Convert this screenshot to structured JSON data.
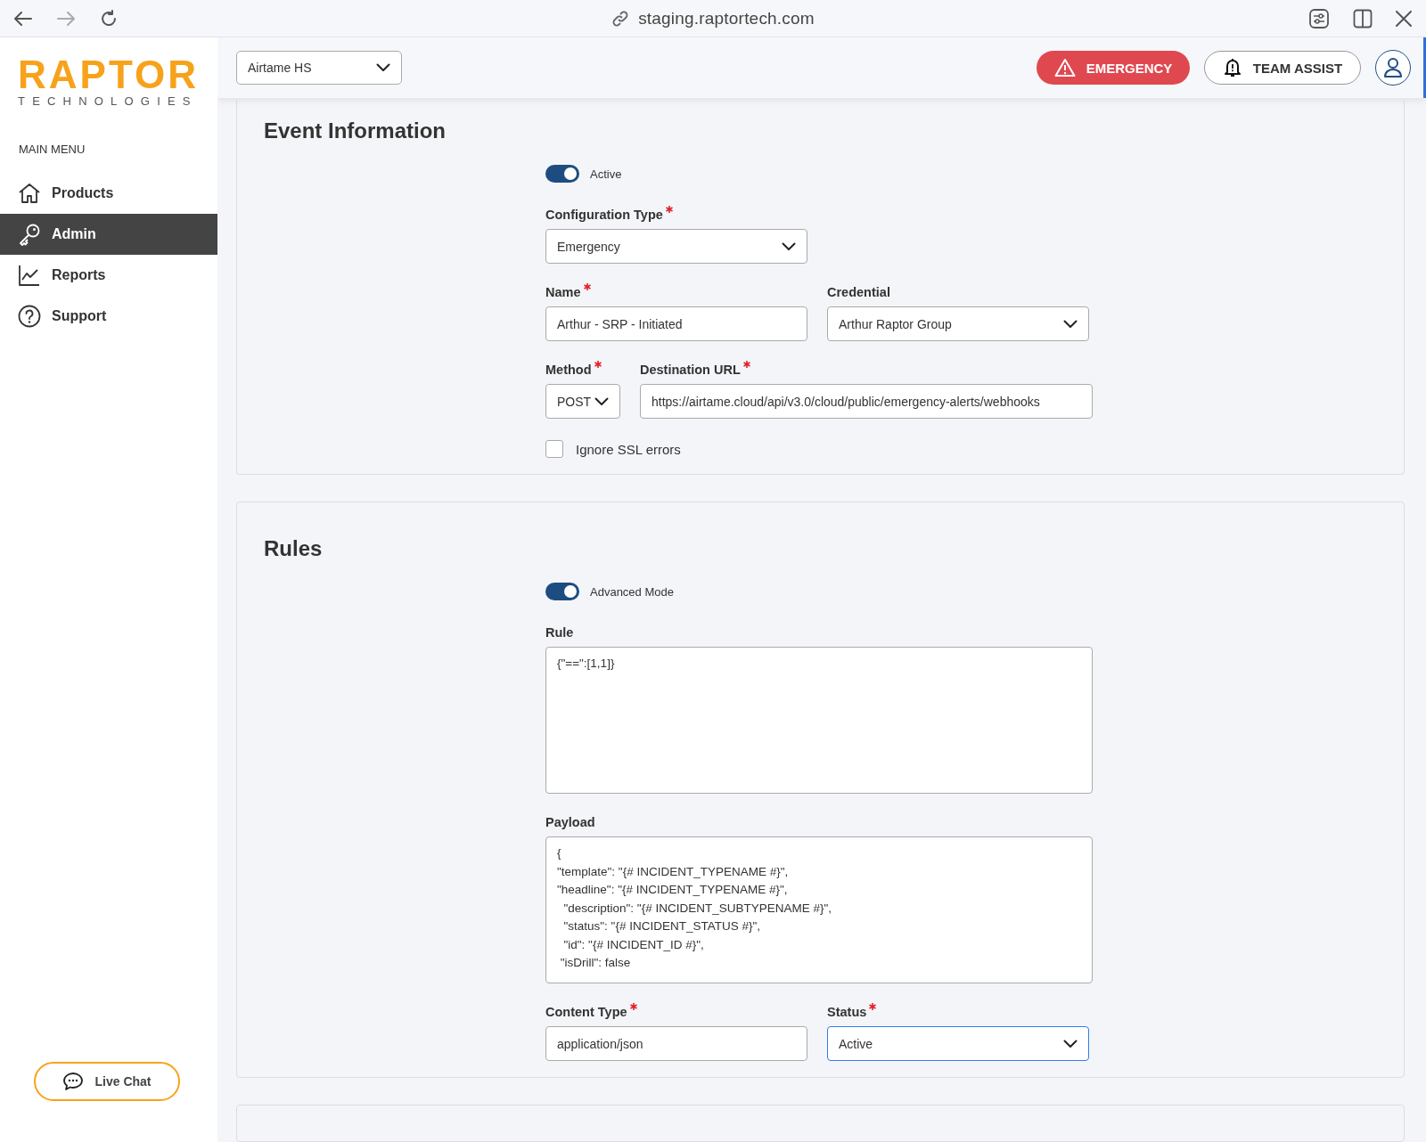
{
  "browser": {
    "url": "staging.raptortech.com"
  },
  "logo": {
    "name": "RAPTOR",
    "tagline": "TECHNOLOGIES"
  },
  "sidebar": {
    "heading": "MAIN MENU",
    "items": [
      {
        "label": "Products",
        "selected": false
      },
      {
        "label": "Admin",
        "selected": true
      },
      {
        "label": "Reports",
        "selected": false
      },
      {
        "label": "Support",
        "selected": false
      }
    ],
    "live_chat": "Live Chat"
  },
  "header": {
    "site_select": "Airtame HS",
    "emergency": "EMERGENCY",
    "team_assist": "TEAM ASSIST"
  },
  "sections": [
    {
      "title": "Event Information",
      "rows": [
        [
          {
            "kind": "toggle",
            "label": "Active",
            "on": true
          }
        ],
        [
          {
            "kind": "select",
            "label": "Configuration Type",
            "required": true,
            "value": "Emergency",
            "focused": false
          }
        ],
        [
          {
            "kind": "input",
            "label": "Name",
            "required": true,
            "value": "Arthur - SRP - Initiated"
          },
          {
            "kind": "select",
            "label": "Credential",
            "required": false,
            "value": "Arthur Raptor Group",
            "focused": false
          }
        ],
        [
          {
            "kind": "compact-select",
            "label": "Method",
            "required": true,
            "value": "POST",
            "focused": false
          },
          {
            "kind": "wide-input",
            "label": "Destination URL",
            "required": true,
            "value": "https://airtame.cloud/api/v3.0/cloud/public/emergency-alerts/webhooks"
          }
        ],
        [
          {
            "kind": "checkbox",
            "label": "Ignore SSL errors",
            "checked": false
          }
        ]
      ]
    },
    {
      "title": "Rules",
      "rows": [
        [
          {
            "kind": "toggle",
            "label": "Advanced Mode",
            "on": true
          }
        ],
        [
          {
            "kind": "textarea",
            "label": "Rule",
            "required": false,
            "value": "{\"==\":[1,1]}"
          }
        ],
        [
          {
            "kind": "textarea",
            "label": "Payload",
            "required": false,
            "value": "{\n\"template\": \"{# INCIDENT_TYPENAME #}\",\n\"headline\": \"{# INCIDENT_TYPENAME #}\",\n  \"description\": \"{# INCIDENT_SUBTYPENAME #}\",\n  \"status\": \"{# INCIDENT_STATUS #}\",\n  \"id\": \"{# INCIDENT_ID #}\",\n \"isDrill\": false"
          }
        ],
        [
          {
            "kind": "input",
            "label": "Content Type",
            "required": true,
            "value": "application/json"
          },
          {
            "kind": "select",
            "label": "Status",
            "required": true,
            "value": "Active",
            "focused": true
          }
        ]
      ]
    }
  ]
}
